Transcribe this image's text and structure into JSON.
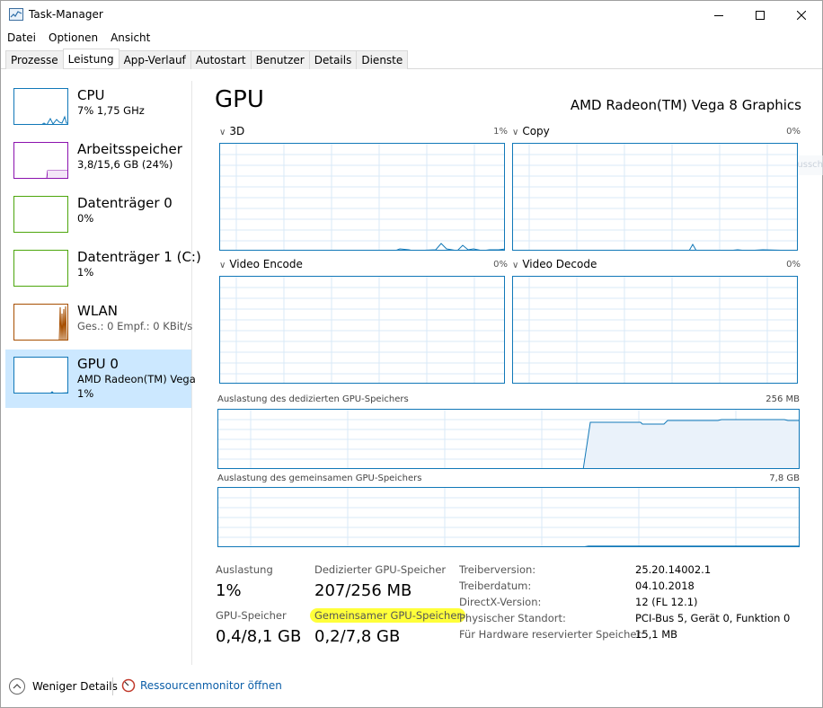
{
  "window": {
    "title": "Task-Manager"
  },
  "menu": [
    "Datei",
    "Optionen",
    "Ansicht"
  ],
  "tabs": [
    {
      "label": "Prozesse",
      "active": false
    },
    {
      "label": "Leistung",
      "active": true
    },
    {
      "label": "App-Verlauf",
      "active": false
    },
    {
      "label": "Autostart",
      "active": false
    },
    {
      "label": "Benutzer",
      "active": false
    },
    {
      "label": "Details",
      "active": false
    },
    {
      "label": "Dienste",
      "active": false
    }
  ],
  "sidebar": {
    "items": [
      {
        "title": "CPU",
        "sub": "7%  1,75 GHz",
        "sub2": "",
        "color": "#1178b8",
        "selected": false
      },
      {
        "title": "Arbeitsspeicher",
        "sub": "3,8/15,6 GB (24%)",
        "sub2": "",
        "color": "#8b12ae",
        "selected": false
      },
      {
        "title": "Datenträger 0",
        "sub": "0%",
        "sub2": "",
        "color": "#4da60c",
        "selected": false
      },
      {
        "title": "Datenträger 1 (C:)",
        "sub": "1%",
        "sub2": "",
        "color": "#4da60c",
        "selected": false
      },
      {
        "title": "WLAN",
        "sub_label": "Ges.: 0  Empf.: 0 KBit/s",
        "sub": "Ges.: 0  Empf.: 0 KBit/s",
        "sub2": "",
        "color": "#a74f01",
        "selected": false
      },
      {
        "title": "GPU 0",
        "sub": "AMD Radeon(TM) Vega",
        "sub2": "1%",
        "color": "#1178b8",
        "selected": true
      }
    ]
  },
  "main": {
    "heading": "GPU",
    "model": "AMD Radeon(TM) Vega 8 Graphics",
    "engines": [
      {
        "name": "3D",
        "pct": "1%"
      },
      {
        "name": "Copy",
        "pct": "0%"
      },
      {
        "name": "Video Encode",
        "pct": "0%"
      },
      {
        "name": "Video Decode",
        "pct": "0%"
      }
    ],
    "dedicated": {
      "label": "Auslastung des dedizierten GPU-Speichers",
      "max": "256 MB"
    },
    "shared": {
      "label": "Auslastung des gemeinsamen GPU-Speichers",
      "max": "7,8 GB"
    },
    "ghost_text": "Fenster ausschließen"
  },
  "stats": {
    "utilization_label": "Auslastung",
    "utilization_value": "1%",
    "gpu_mem_label": "GPU-Speicher",
    "gpu_mem_value": "0,4/8,1 GB",
    "dedicated_label": "Dedizierter GPU-Speicher",
    "dedicated_value": "207/256 MB",
    "shared_label": "Gemeinsamer GPU-Speicher",
    "shared_value": "0,2/7,8 GB"
  },
  "info": [
    {
      "label": "Treiberversion:",
      "value": "25.20.14002.1"
    },
    {
      "label": "Treiberdatum:",
      "value": "04.10.2018"
    },
    {
      "label": "DirectX-Version:",
      "value": "12 (FL 12.1)"
    },
    {
      "label": "Physischer Standort:",
      "value": "PCI-Bus 5, Gerät 0, Funktion 0"
    },
    {
      "label": "Für Hardware reservierter Speicher:",
      "value": "15,1 MB"
    }
  ],
  "footer": {
    "fewer_details": "Weniger Details",
    "resource_monitor": "Ressourcenmonitor öffnen"
  },
  "colors": {
    "accent": "#1178b8",
    "selected_bg": "#cce8ff",
    "highlight": "#ffff3a"
  }
}
